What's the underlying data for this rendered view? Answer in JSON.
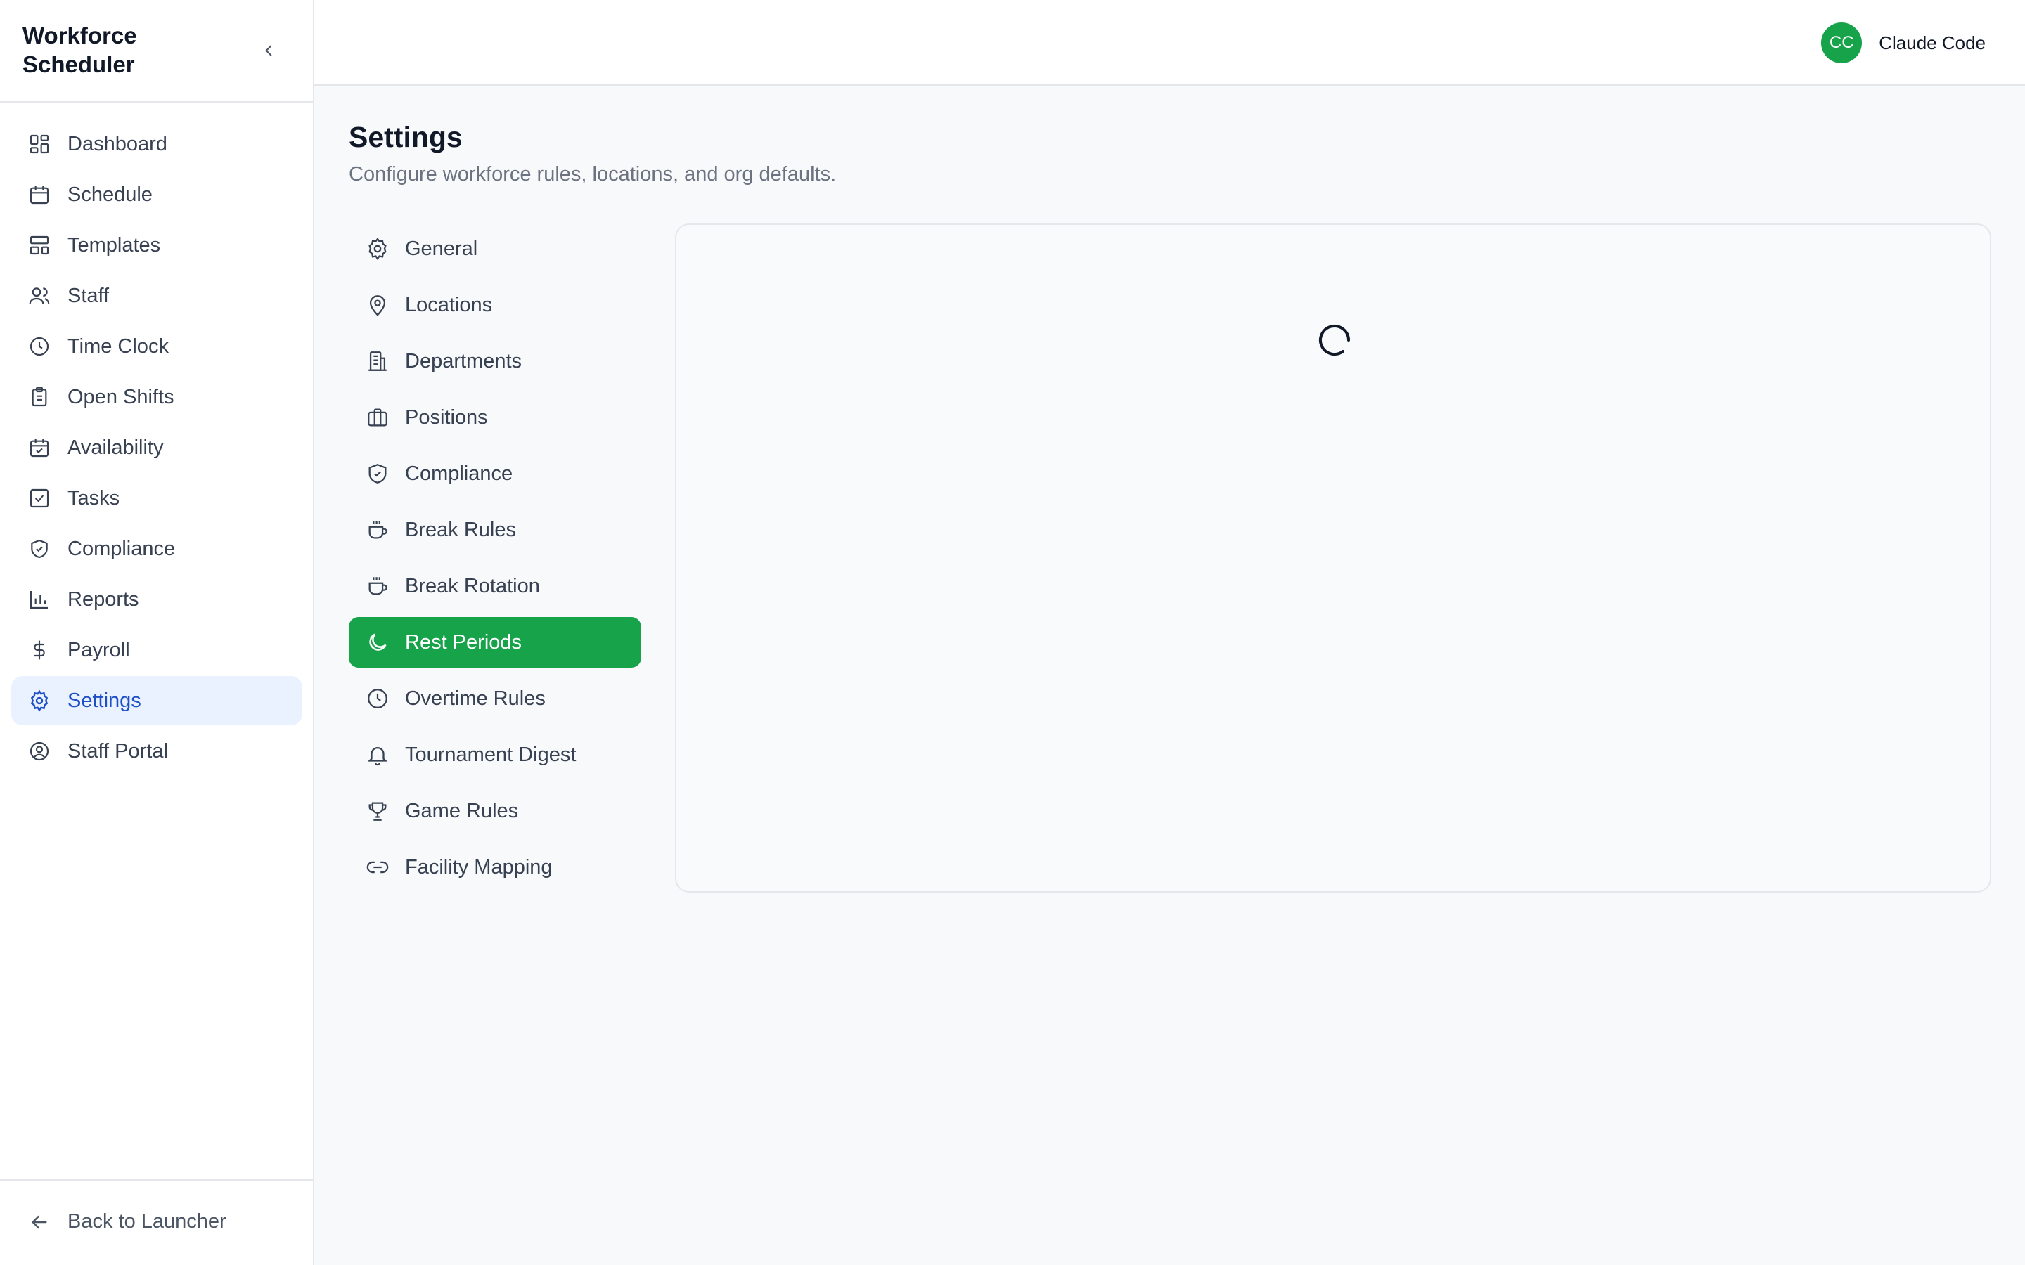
{
  "app": {
    "title": "Workforce Scheduler"
  },
  "sidebar": {
    "items": [
      {
        "label": "Dashboard",
        "icon": "dashboard-icon"
      },
      {
        "label": "Schedule",
        "icon": "calendar-icon"
      },
      {
        "label": "Templates",
        "icon": "templates-icon"
      },
      {
        "label": "Staff",
        "icon": "users-icon"
      },
      {
        "label": "Time Clock",
        "icon": "clock-icon"
      },
      {
        "label": "Open Shifts",
        "icon": "clipboard-icon"
      },
      {
        "label": "Availability",
        "icon": "calendar-check-icon"
      },
      {
        "label": "Tasks",
        "icon": "checkbox-icon"
      },
      {
        "label": "Compliance",
        "icon": "shield-icon"
      },
      {
        "label": "Reports",
        "icon": "bar-chart-icon"
      },
      {
        "label": "Payroll",
        "icon": "dollar-icon"
      },
      {
        "label": "Settings",
        "icon": "gear-icon",
        "active": true
      },
      {
        "label": "Staff Portal",
        "icon": "user-circle-icon"
      }
    ],
    "footer": {
      "back_label": "Back to Launcher"
    }
  },
  "user": {
    "initials": "CC",
    "name": "Claude Code",
    "avatar_color": "#16a34a"
  },
  "page": {
    "title": "Settings",
    "subtitle": "Configure workforce rules, locations, and org defaults."
  },
  "settings_nav": {
    "items": [
      {
        "label": "General",
        "icon": "gear-icon"
      },
      {
        "label": "Locations",
        "icon": "map-pin-icon"
      },
      {
        "label": "Departments",
        "icon": "building-icon"
      },
      {
        "label": "Positions",
        "icon": "briefcase-icon"
      },
      {
        "label": "Compliance",
        "icon": "shield-check-icon"
      },
      {
        "label": "Break Rules",
        "icon": "coffee-icon"
      },
      {
        "label": "Break Rotation",
        "icon": "coffee-icon"
      },
      {
        "label": "Rest Periods",
        "icon": "moon-icon",
        "active": true
      },
      {
        "label": "Overtime Rules",
        "icon": "clock-icon"
      },
      {
        "label": "Tournament Digest",
        "icon": "bell-icon"
      },
      {
        "label": "Game Rules",
        "icon": "trophy-icon"
      },
      {
        "label": "Facility Mapping",
        "icon": "link-icon"
      }
    ]
  },
  "panel": {
    "state": "loading"
  },
  "colors": {
    "accent": "#16a34a",
    "active_nav_bg": "#eaf2ff",
    "active_nav_text": "#1d4fc7"
  }
}
